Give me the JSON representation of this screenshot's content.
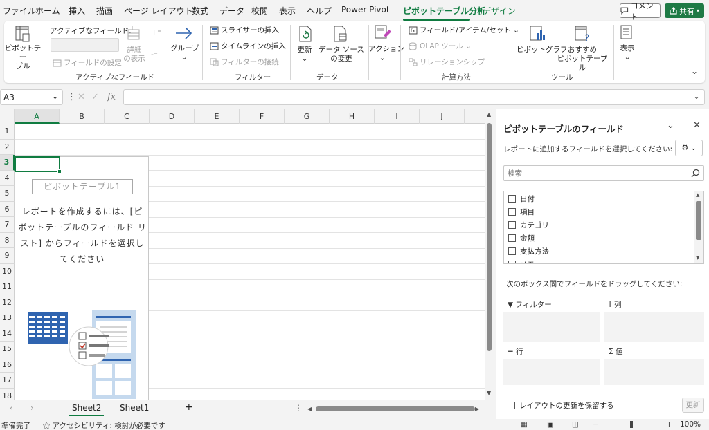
{
  "menu": {
    "tabs": [
      {
        "label": "ファイル"
      },
      {
        "label": "ホーム"
      },
      {
        "label": "挿入"
      },
      {
        "label": "描画"
      },
      {
        "label": "ページ レイアウト"
      },
      {
        "label": "数式"
      },
      {
        "label": "データ"
      },
      {
        "label": "校閲"
      },
      {
        "label": "表示"
      },
      {
        "label": "ヘルプ"
      },
      {
        "label": "Power Pivot"
      },
      {
        "label": "ピボットテーブル分析"
      },
      {
        "label": "デザイン"
      }
    ],
    "active_tab": "ピボットテーブル分析",
    "comment_label": "コメント",
    "share_label": "共有"
  },
  "ribbon": {
    "pivottable_label": "ピボットテー\nブル",
    "active_field_title": "アクティブなフィールド:",
    "field_settings_label": "フィールドの設定",
    "detail_label": "詳細\nの表示",
    "active_field_group": "アクティブなフィールド",
    "group_label": "グループ",
    "slicer_label": "スライサーの挿入",
    "timeline_label": "タイムラインの挿入",
    "filter_conn_label": "フィルターの接続",
    "filter_group": "フィルター",
    "refresh_label": "更新",
    "datasource_label": "データ ソース\nの変更",
    "data_group": "データ",
    "action_label": "アクション",
    "fields_items_label": "フィールド/アイテム/セット",
    "olap_label": "OLAP ツール",
    "relationships_label": "リレーションシップ",
    "calc_group": "計算方法",
    "pivotchart_label": "ピボットグラフ",
    "recommended_label": "おすすめ\nピボットテーブル",
    "tools_group": "ツール",
    "show_label": "表示"
  },
  "formula_bar": {
    "name_box": "A3",
    "fx": "fx",
    "value": ""
  },
  "grid": {
    "columns": [
      "A",
      "B",
      "C",
      "D",
      "E",
      "F",
      "G",
      "H",
      "I",
      "J"
    ],
    "rows": [
      "1",
      "2",
      "3",
      "4",
      "5",
      "6",
      "7",
      "8",
      "9",
      "10",
      "11",
      "12",
      "13",
      "14",
      "15",
      "16",
      "17",
      "18"
    ],
    "selected_cell": "A3"
  },
  "pivot": {
    "title": "ピボットテーブル1",
    "instructions": "レポートを作成するには、[ピボットテーブルのフィールド リスト] からフィールドを選択してください"
  },
  "sheets": {
    "tabs": [
      "Sheet2",
      "Sheet1"
    ],
    "active": "Sheet2"
  },
  "status": {
    "ready": "準備完了",
    "accessibility": "アクセシビリティ: 検討が必要です",
    "zoom": "100%"
  },
  "field_pane": {
    "title": "ピボットテーブルのフィールド",
    "subtitle": "レポートに追加するフィールドを選択してください:",
    "search_placeholder": "検索",
    "fields": [
      "日付",
      "項目",
      "カテゴリ",
      "金額",
      "支払方法",
      "メモ"
    ],
    "drag_label": "次のボックス間でフィールドをドラッグしてください:",
    "areas": {
      "filter": "フィルター",
      "columns": "列",
      "rows": "行",
      "values": "値"
    },
    "defer_label": "レイアウトの更新を保留する",
    "update_label": "更新"
  },
  "colors": {
    "accent": "#107c41",
    "share_bg": "#1e7a45",
    "pivot_illustration_blue": "#2f64b0"
  }
}
